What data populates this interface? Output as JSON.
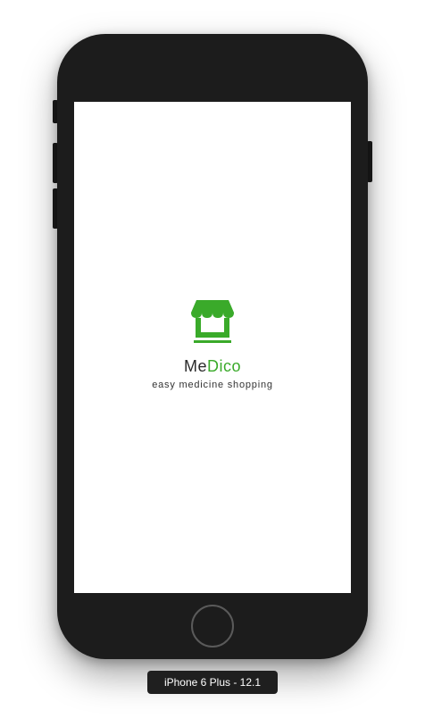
{
  "app": {
    "name_part1": "Me",
    "name_part2": "Dico",
    "tagline": "easy medicine shopping",
    "logo_icon": "storefront-icon",
    "accent_color": "#3aaa2a"
  },
  "simulator": {
    "device_label": "iPhone 6 Plus - 12.1"
  }
}
